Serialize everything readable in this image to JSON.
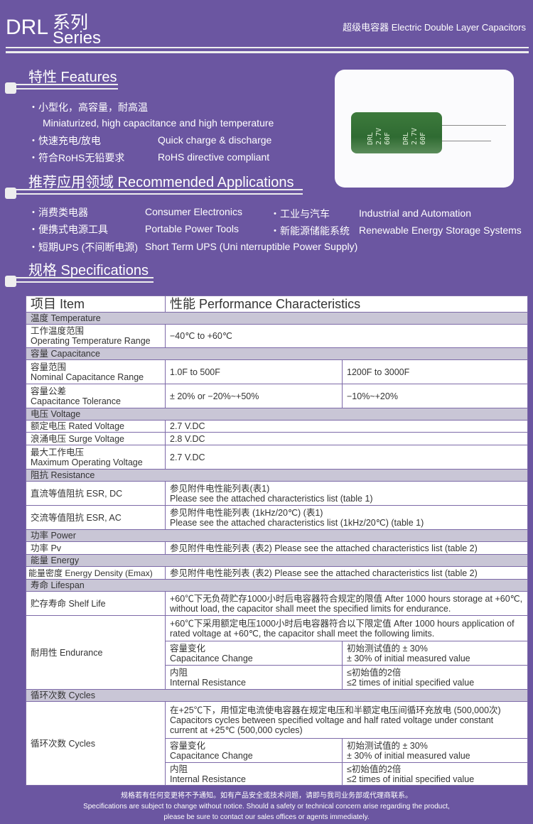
{
  "header": {
    "model": "DRL",
    "series_cn": "系列",
    "series_en": "Series",
    "subtitle": "超级电容器 Electric Double Layer Capacitors"
  },
  "features": {
    "title": "特性 Features",
    "items": [
      {
        "cn": "・小型化，高容量，耐高温",
        "en": "Miniaturized, high capacitance and high temperature"
      },
      {
        "cn": "・快速充电/放电",
        "en": "Quick charge & discharge"
      },
      {
        "cn": "・符合RoHS无铅要求",
        "en": "RoHS directive compliant"
      }
    ]
  },
  "product_image": {
    "print_lines": [
      "DRL",
      "2.7V",
      "60F"
    ],
    "body_color": "#2f6b32"
  },
  "applications": {
    "title": "推荐应用领域 Recommended Applications",
    "items": [
      {
        "cn": "・消费类电器",
        "en": "Consumer Electronics"
      },
      {
        "cn": "・工业与汽车",
        "en": "Industrial and Automation"
      },
      {
        "cn": "・便携式电源工具",
        "en": "Portable Power Tools"
      },
      {
        "cn": "・新能源储能系统",
        "en": "Renewable Energy Storage Systems"
      },
      {
        "cn": "・短期UPS (不间断电源)",
        "en": "Short Term UPS (Uni nterruptible Power Supply)"
      }
    ]
  },
  "specs": {
    "title": "规格 Specifications",
    "col_item": "项目 Item",
    "col_perf": "性能 Performance Characteristics",
    "temperature": "温度 Temperature",
    "op_temp_cn": "工作温度范围",
    "op_temp_en": "Operating Temperature Range",
    "op_temp_val": "−40℃ to +60℃",
    "capacitance": "容量 Capacitance",
    "nom_cn": "容量范围",
    "nom_en": "Nominal Capacitance Range",
    "nom_v1": "1.0F to 500F",
    "nom_v2": "1200F to 3000F",
    "tol_cn": "容量公差",
    "tol_en": "Capacitance Tolerance",
    "tol_v1": "± 20% or −20%~+50%",
    "tol_v2": "−10%~+20%",
    "voltage": "电压 Voltage",
    "rated": "额定电压 Rated Voltage",
    "rated_v": "2.7 V.DC",
    "surge": "浪涌电压 Surge Voltage",
    "surge_v": "2.8 V.DC",
    "maxop_cn": "最大工作电压",
    "maxop_en": "Maximum Operating Voltage",
    "maxop_v": "2.7 V.DC",
    "resistance": "阻抗 Resistance",
    "esrdc": "直流等值阻抗 ESR, DC",
    "esrdc_v1": "参见附件电性能列表(表1)",
    "esrdc_v2": "Please see the attached characteristics list (table 1)",
    "esrac": "交流等值阻抗 ESR, AC",
    "esrac_v1": "参见附件电性能列表 (1kHz/20℃) (表1)",
    "esrac_v2": "Please see the attached characteristics list (1kHz/20℃) (table 1)",
    "power": "功率 Power",
    "pv": "功率 Pv",
    "pv_v": "参见附件电性能列表 (表2) Please see the attached characteristics list (table 2)",
    "energy": "能量 Energy",
    "ed": "能量密度 Energy Density (Emax)",
    "ed_v": "参见附件电性能列表 (表2) Please see the attached characteristics list (table 2)",
    "lifespan": "寿命 Lifespan",
    "shelf": "贮存寿命 Shelf Life",
    "shelf_v": "+60℃下无负荷贮存1000小时后电容器符合规定的限值 After 1000 hours storage at +60℃, without load, the capacitor shall meet the specified limits for endurance.",
    "endur": "耐用性 Endurance",
    "endur_v": "+60℃下采用额定电压1000小时后电容器符合以下限定值 After 1000 hours application of rated voltage at +60℃, the capacitor shall meet the following limits.",
    "capchg_cn": "容量变化",
    "capchg_en": "Capacitance Change",
    "capchg_v1": "初始测试值的 ± 30%",
    "capchg_v2": "± 30% of initial measured value",
    "ir_cn": "内阻",
    "ir_en": "Internal Resistance",
    "ir_v1": "≤初始值的2倍",
    "ir_v2": "≤2 times of initial specified value",
    "cycles_head": "循环次数 Cycles",
    "cycles": "循环次数 Cycles",
    "cycles_v": "在+25℃下，用恒定电流使电容器在规定电压和半额定电压间循环充放电 (500,000次) Capacitors cycles between specified voltage and half rated voltage under constant current at +25℃ (500,000 cycles)"
  },
  "footer": {
    "cn": "规格若有任何变更将不予通知。如有产品安全或技术问题，请即与我司业务部或代理商联系。",
    "en1": "Specifications are subject to change without notice. Should a safety or technical concern arise regarding the product,",
    "en2": "please be sure to contact our sales offices or agents immediately."
  }
}
